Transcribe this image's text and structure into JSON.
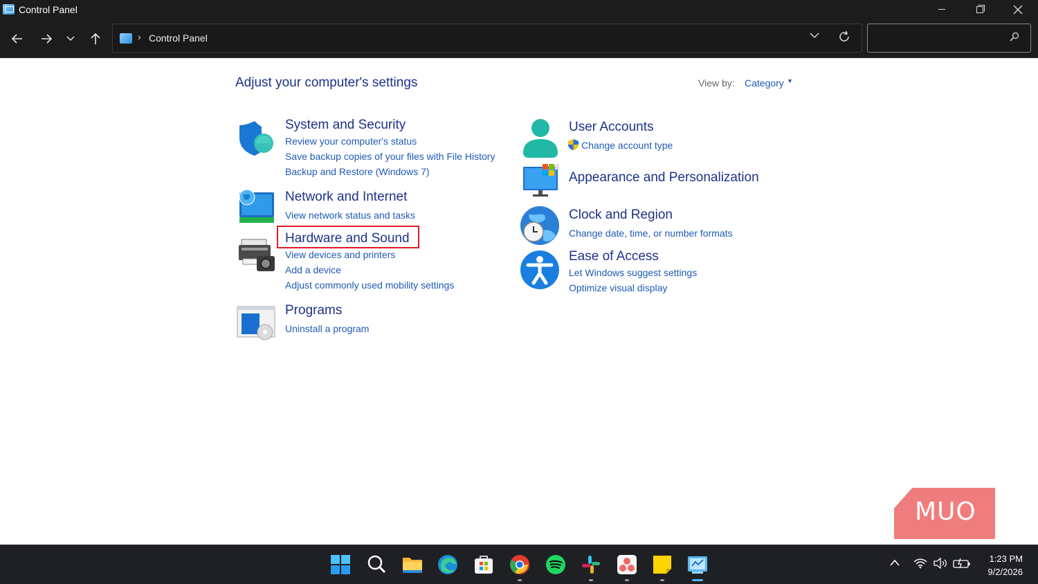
{
  "window": {
    "title": "Control Panel"
  },
  "nav": {
    "breadcrumb": "Control Panel",
    "breadcrumb_separator": "›",
    "search_placeholder": ""
  },
  "main": {
    "heading": "Adjust your computer's settings",
    "view_by_label": "View by:",
    "view_by_value": "Category",
    "categories_left": [
      {
        "title": "System and Security",
        "links": [
          "Review your computer's status",
          "Save backup copies of your files with File History",
          "Backup and Restore (Windows 7)"
        ],
        "icon": "shield-icon"
      },
      {
        "title": "Network and Internet",
        "links": [
          "View network status and tasks"
        ],
        "icon": "network-globe-icon"
      },
      {
        "title": "Hardware and Sound",
        "links": [
          "View devices and printers",
          "Add a device",
          "Adjust commonly used mobility settings"
        ],
        "icon": "printer-icon",
        "highlighted": true
      },
      {
        "title": "Programs",
        "links": [
          "Uninstall a program"
        ],
        "icon": "programs-icon"
      }
    ],
    "categories_right": [
      {
        "title": "User Accounts",
        "links": [
          "Change account type"
        ],
        "icon": "user-icon"
      },
      {
        "title": "Appearance and Personalization",
        "links": [],
        "icon": "monitor-icon"
      },
      {
        "title": "Clock and Region",
        "links": [
          "Change date, time, or number formats"
        ],
        "icon": "clock-globe-icon"
      },
      {
        "title": "Ease of Access",
        "links": [
          "Let Windows suggest settings",
          "Optimize visual display"
        ],
        "icon": "accessibility-icon"
      }
    ]
  },
  "watermark": {
    "text": "MUO"
  },
  "taskbar": {
    "apps": [
      "windows-start-icon",
      "search-icon",
      "file-explorer-icon",
      "edge-icon",
      "store-icon",
      "chrome-icon",
      "spotify-icon",
      "slack-icon",
      "asana-icon",
      "sticky-notes-icon",
      "control-panel-icon"
    ],
    "time": "1:23 PM",
    "date": "9/2/2026"
  },
  "colors": {
    "title_blue": "#1e3287",
    "link_blue": "#1e5ab4",
    "highlight_red": "#e01b24",
    "taskbar_bg": "#1f2024"
  }
}
